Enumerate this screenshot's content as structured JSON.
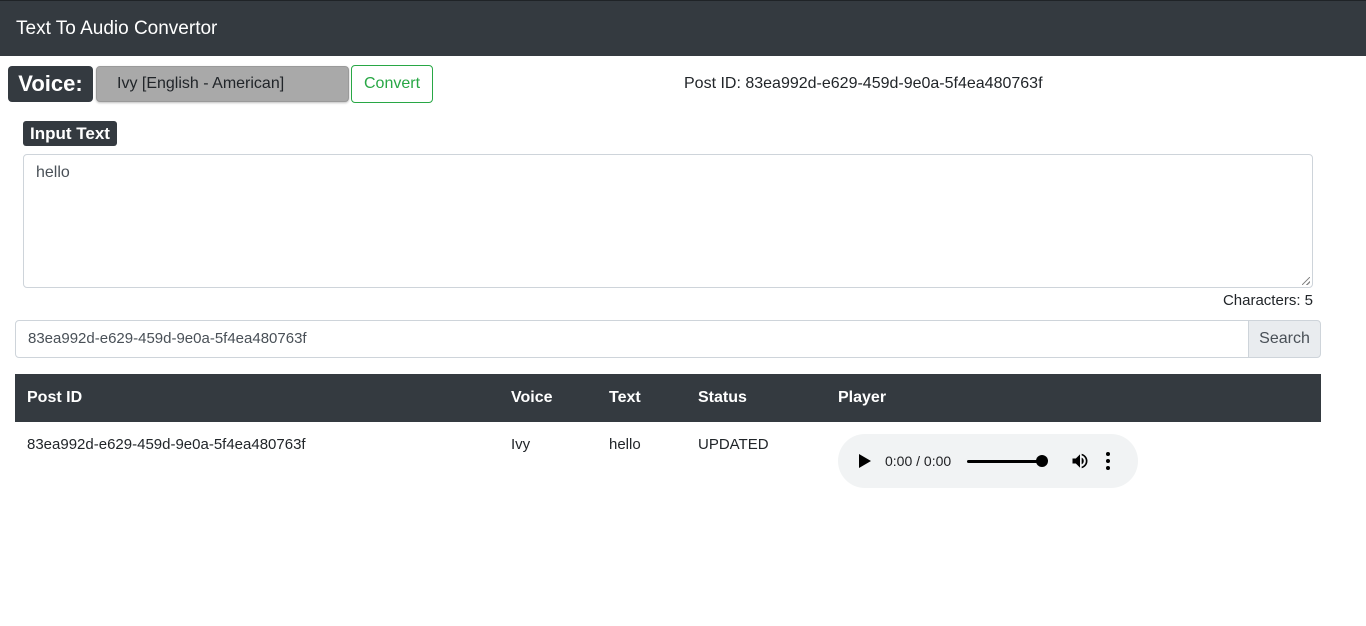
{
  "header": {
    "title": "Text To Audio Convertor"
  },
  "toolbar": {
    "voice_label": "Voice:",
    "voice_selected": "Ivy [English - American]",
    "convert_label": "Convert",
    "post_id_text": "Post ID: 83ea992d-e629-459d-9e0a-5f4ea480763f"
  },
  "input": {
    "label": "Input Text",
    "value": "hello",
    "char_count": "Characters: 5"
  },
  "search": {
    "value": "83ea992d-e629-459d-9e0a-5f4ea480763f",
    "button_label": "Search"
  },
  "table": {
    "headers": [
      "Post ID",
      "Voice",
      "Text",
      "Status",
      "Player"
    ],
    "rows": [
      {
        "post_id": "83ea992d-e629-459d-9e0a-5f4ea480763f",
        "voice": "Ivy",
        "text": "hello",
        "status": "UPDATED",
        "player": {
          "time": "0:00 / 0:00",
          "volume": 1.0
        }
      }
    ]
  },
  "colors": {
    "navbar": "#343a40",
    "convert_accent": "#28a745",
    "select_bg": "#a9a9a9"
  },
  "icons": {
    "play": "play-icon",
    "volume": "volume-icon",
    "menu": "more-vert-icon"
  }
}
